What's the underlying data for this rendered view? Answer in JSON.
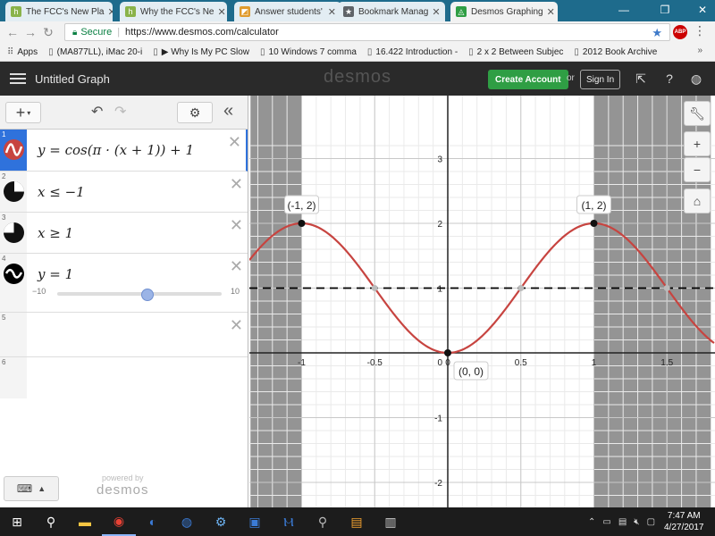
{
  "browser": {
    "tabs": [
      {
        "title": "The FCC's New Pla",
        "icon": "h",
        "icon_color": "#8ab34a",
        "active": false
      },
      {
        "title": "Why the FCC's Ne",
        "icon": "h",
        "icon_color": "#8ab34a",
        "active": false
      },
      {
        "title": "Answer students'",
        "icon": "◩",
        "icon_color": "#e09b2d",
        "active": false
      },
      {
        "title": "Bookmark Manag",
        "icon": "★",
        "icon_color": "#5f6368",
        "active": false
      },
      {
        "title": "Desmos Graphing",
        "icon": "◬",
        "icon_color": "#2f9e44",
        "active": true
      }
    ],
    "secure_label": "Secure",
    "url": "https://www.desmos.com/calculator",
    "bookmarks": [
      {
        "icon": "grid-icon",
        "label": "Apps"
      },
      {
        "icon": "page-icon",
        "label": "(MA877LL), iMac 20-i"
      },
      {
        "icon": "page-icon",
        "label": "▶ Why Is My PC Slow"
      },
      {
        "icon": "page-icon",
        "label": "10 Windows 7 comma"
      },
      {
        "icon": "page-icon",
        "label": "16.422 Introduction -"
      },
      {
        "icon": "page-icon",
        "label": "2 x 2 Between Subjec"
      },
      {
        "icon": "page-icon",
        "label": "2012 Book Archive"
      }
    ],
    "more": "»"
  },
  "header": {
    "graph_title": "Untitled Graph",
    "logo": "desmos",
    "create_account": "Create Account",
    "or": "or",
    "sign_in": "Sign In"
  },
  "expressions": [
    {
      "index": "1",
      "latex": "y  =  cos(π · (x + 1)) + 1",
      "color": "#c74440",
      "focused": true
    },
    {
      "index": "2",
      "latex": "x ≤ −1",
      "color": "#222222",
      "focused": false
    },
    {
      "index": "3",
      "latex": "x ≥ 1",
      "color": "#222222",
      "focused": false
    },
    {
      "index": "4",
      "latex": "y  =  1",
      "color": "#000000",
      "focused": false,
      "slider": {
        "min": "−10",
        "max": "10",
        "value": 1
      }
    },
    {
      "index": "5",
      "latex": "",
      "focused": false
    },
    {
      "index": "6",
      "latex": "",
      "focused": false
    }
  ],
  "powered_by": "powered by",
  "powered_logo": "desmos",
  "chart_data": {
    "type": "line",
    "title": "",
    "xlabel": "",
    "ylabel": "",
    "xlim": [
      -1.35,
      1.8
    ],
    "ylim": [
      -2.3,
      3.4
    ],
    "grid": true,
    "x_ticks": [
      -1,
      -0.5,
      0,
      0.5,
      1,
      1.5
    ],
    "x_tick_labels": [
      "-1",
      "-0.5",
      "0",
      "0.5",
      "1",
      "1.5"
    ],
    "y_ticks": [
      -2,
      -1,
      1,
      2,
      3
    ],
    "y_tick_labels": [
      "-2",
      "-1",
      "1",
      "2",
      "3"
    ],
    "origin_label": "0",
    "series": [
      {
        "expr": "cos(pi*(x+1))+1",
        "color": "#c74440",
        "style": "solid"
      },
      {
        "expr": "1",
        "color": "#000000",
        "style": "dashed"
      }
    ],
    "shaded_regions": [
      {
        "from": -1.35,
        "to": -1,
        "label": "x ≤ −1"
      },
      {
        "from": 1,
        "to": 1.8,
        "label": "x ≥ 1"
      }
    ],
    "points": [
      {
        "x": -1,
        "y": 2,
        "label": "(-1, 2)"
      },
      {
        "x": 1,
        "y": 2,
        "label": "(1, 2)"
      },
      {
        "x": 0,
        "y": 0,
        "label": "(0, 0)"
      }
    ]
  },
  "taskbar": {
    "time": "7:47 AM",
    "date": "4/27/2017"
  }
}
